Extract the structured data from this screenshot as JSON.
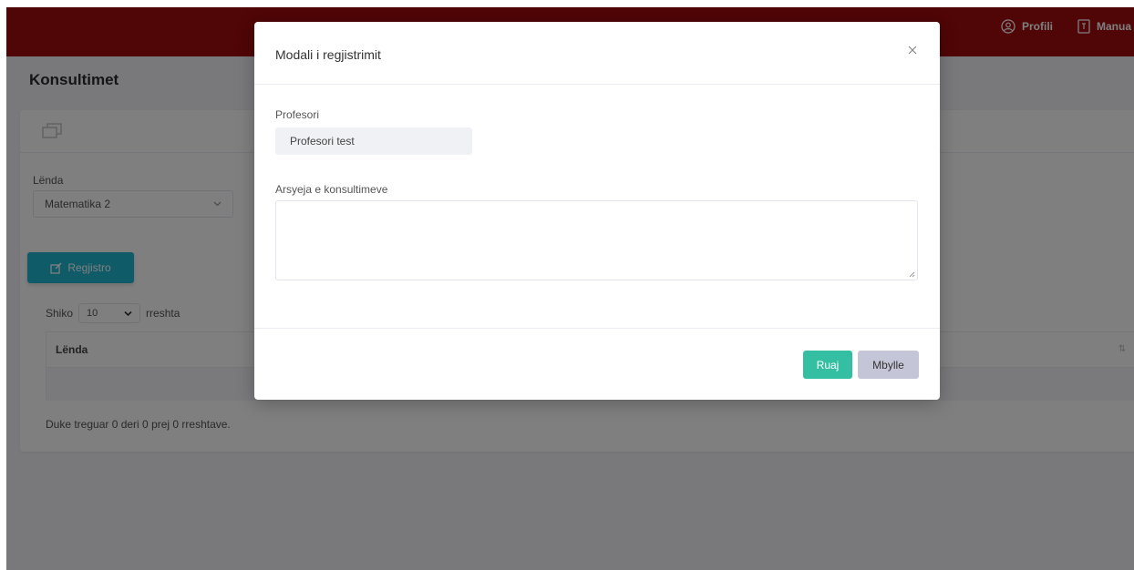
{
  "header": {
    "profile_label": "Profili",
    "manual_label": "Manua"
  },
  "page": {
    "title": "Konsultimet"
  },
  "filters": {
    "subject_label": "Lënda",
    "subject_value": "Matematika 2"
  },
  "actions": {
    "register_label": "Regjistro"
  },
  "table": {
    "show_label": "Shiko",
    "page_size": "10",
    "rows_label": "rreshta",
    "columns": [
      "Lënda"
    ],
    "info": "Duke treguar 0 deri 0 prej 0 rreshtave."
  },
  "modal": {
    "title": "Modali i regjistrimit",
    "professor_label": "Profesori",
    "professor_value": "Profesori test",
    "reason_label": "Arsyeja e konsultimeve",
    "reason_value": "",
    "save_label": "Ruaj",
    "close_label": "Mbylle"
  },
  "colors": {
    "topbar": "#a00a0c",
    "register_button": "#1fb7d1",
    "save_button": "#34bfa3",
    "close_button": "#c4c5d6"
  },
  "icons": {
    "profile": "user-circle-icon",
    "manual": "book-icon",
    "card_head": "layers-icon",
    "register": "edit-icon",
    "close": "close-icon"
  }
}
